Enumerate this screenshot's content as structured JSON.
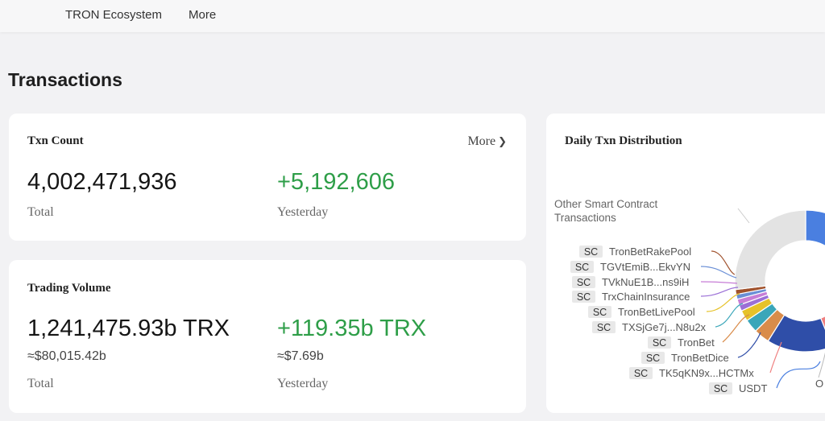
{
  "nav": {
    "items": [
      {
        "label": "TRON Ecosystem"
      },
      {
        "label": "More"
      }
    ]
  },
  "page": {
    "title": "Transactions"
  },
  "txn_count": {
    "title": "Txn Count",
    "more_label": "More",
    "total_value": "4,002,471,936",
    "total_label": "Total",
    "yesterday_value": "+5,192,606",
    "yesterday_label": "Yesterday"
  },
  "trading_volume": {
    "title": "Trading Volume",
    "total_value": "1,241,475.93b TRX",
    "total_approx": "≈$80,015.42b",
    "total_label": "Total",
    "yesterday_value": "+119.35b TRX",
    "yesterday_approx": "≈$7.69b",
    "yesterday_label": "Yesterday"
  },
  "distribution": {
    "title": "Daily Txn Distribution",
    "other_label_line1": "Other Smart Contract",
    "other_label_line2": "Transactions",
    "badge": "SC",
    "contracts": [
      {
        "name": "TronBetRakePool",
        "color": "#a0522d"
      },
      {
        "name": "TGVtEmiB...EkvYN",
        "color": "#6a8fd6"
      },
      {
        "name": "TVkNuE1B...ns9iH",
        "color": "#c77dd6"
      },
      {
        "name": "TrxChainInsurance",
        "color": "#9b6fd6"
      },
      {
        "name": "TronBetLivePool",
        "color": "#e6c229"
      },
      {
        "name": "TXSjGe7j...N8u2x",
        "color": "#3aa6b9"
      },
      {
        "name": "TronBet",
        "color": "#d98c4a"
      },
      {
        "name": "TronBetDice",
        "color": "#2f4ea8"
      },
      {
        "name": "TK5qKN9x...HCTMx",
        "color": "#ef7f7f"
      },
      {
        "name": "USDT",
        "color": "#4a7fe0"
      }
    ],
    "other_color": "#e3e3e3",
    "right_label": "O"
  }
}
